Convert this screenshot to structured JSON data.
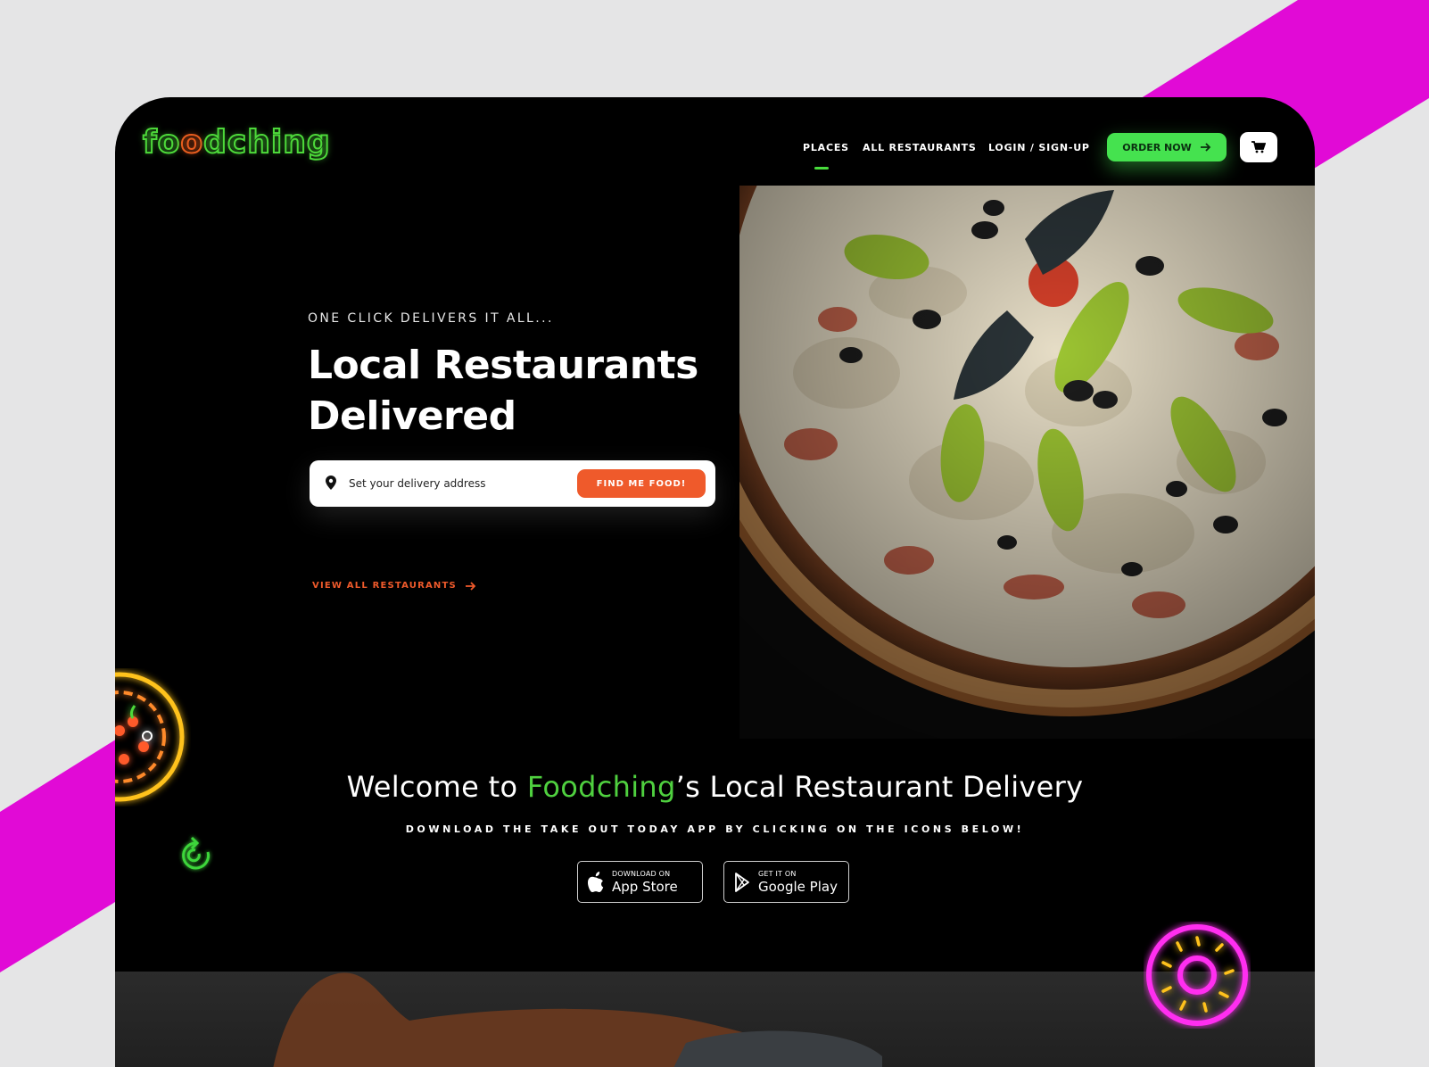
{
  "header": {
    "logo_text": "foodching",
    "nav": [
      "PLACES",
      "ALL RESTAURANTS",
      "LOGIN / SIGN-UP"
    ],
    "order_label": "ORDER NOW"
  },
  "hero": {
    "kicker": "ONE CLICK DELIVERS IT ALL...",
    "title": "Local Restaurants Delivered",
    "search_placeholder": "Set your delivery address",
    "find_label": "FIND ME FOOD!",
    "view_all_label": "VIEW ALL RESTAURANTS"
  },
  "welcome": {
    "prefix": "Welcome to ",
    "brand": "Foodching",
    "suffix": "’s Local Restaurant Delivery",
    "subtitle": "DOWNLOAD THE TAKE OUT TODAY APP BY CLICKING ON THE ICONS BELOW!"
  },
  "stores": [
    {
      "small": "DOWNLOAD ON",
      "big": "App Store",
      "icon": "apple-icon"
    },
    {
      "small": "GET IT ON",
      "big": "Google Play",
      "icon": "google-play-icon"
    }
  ],
  "colors": {
    "accent_green": "#45e24f",
    "accent_orange": "#ef5a2b",
    "stripe_magenta": "#e10ad6",
    "background": "#000000"
  }
}
